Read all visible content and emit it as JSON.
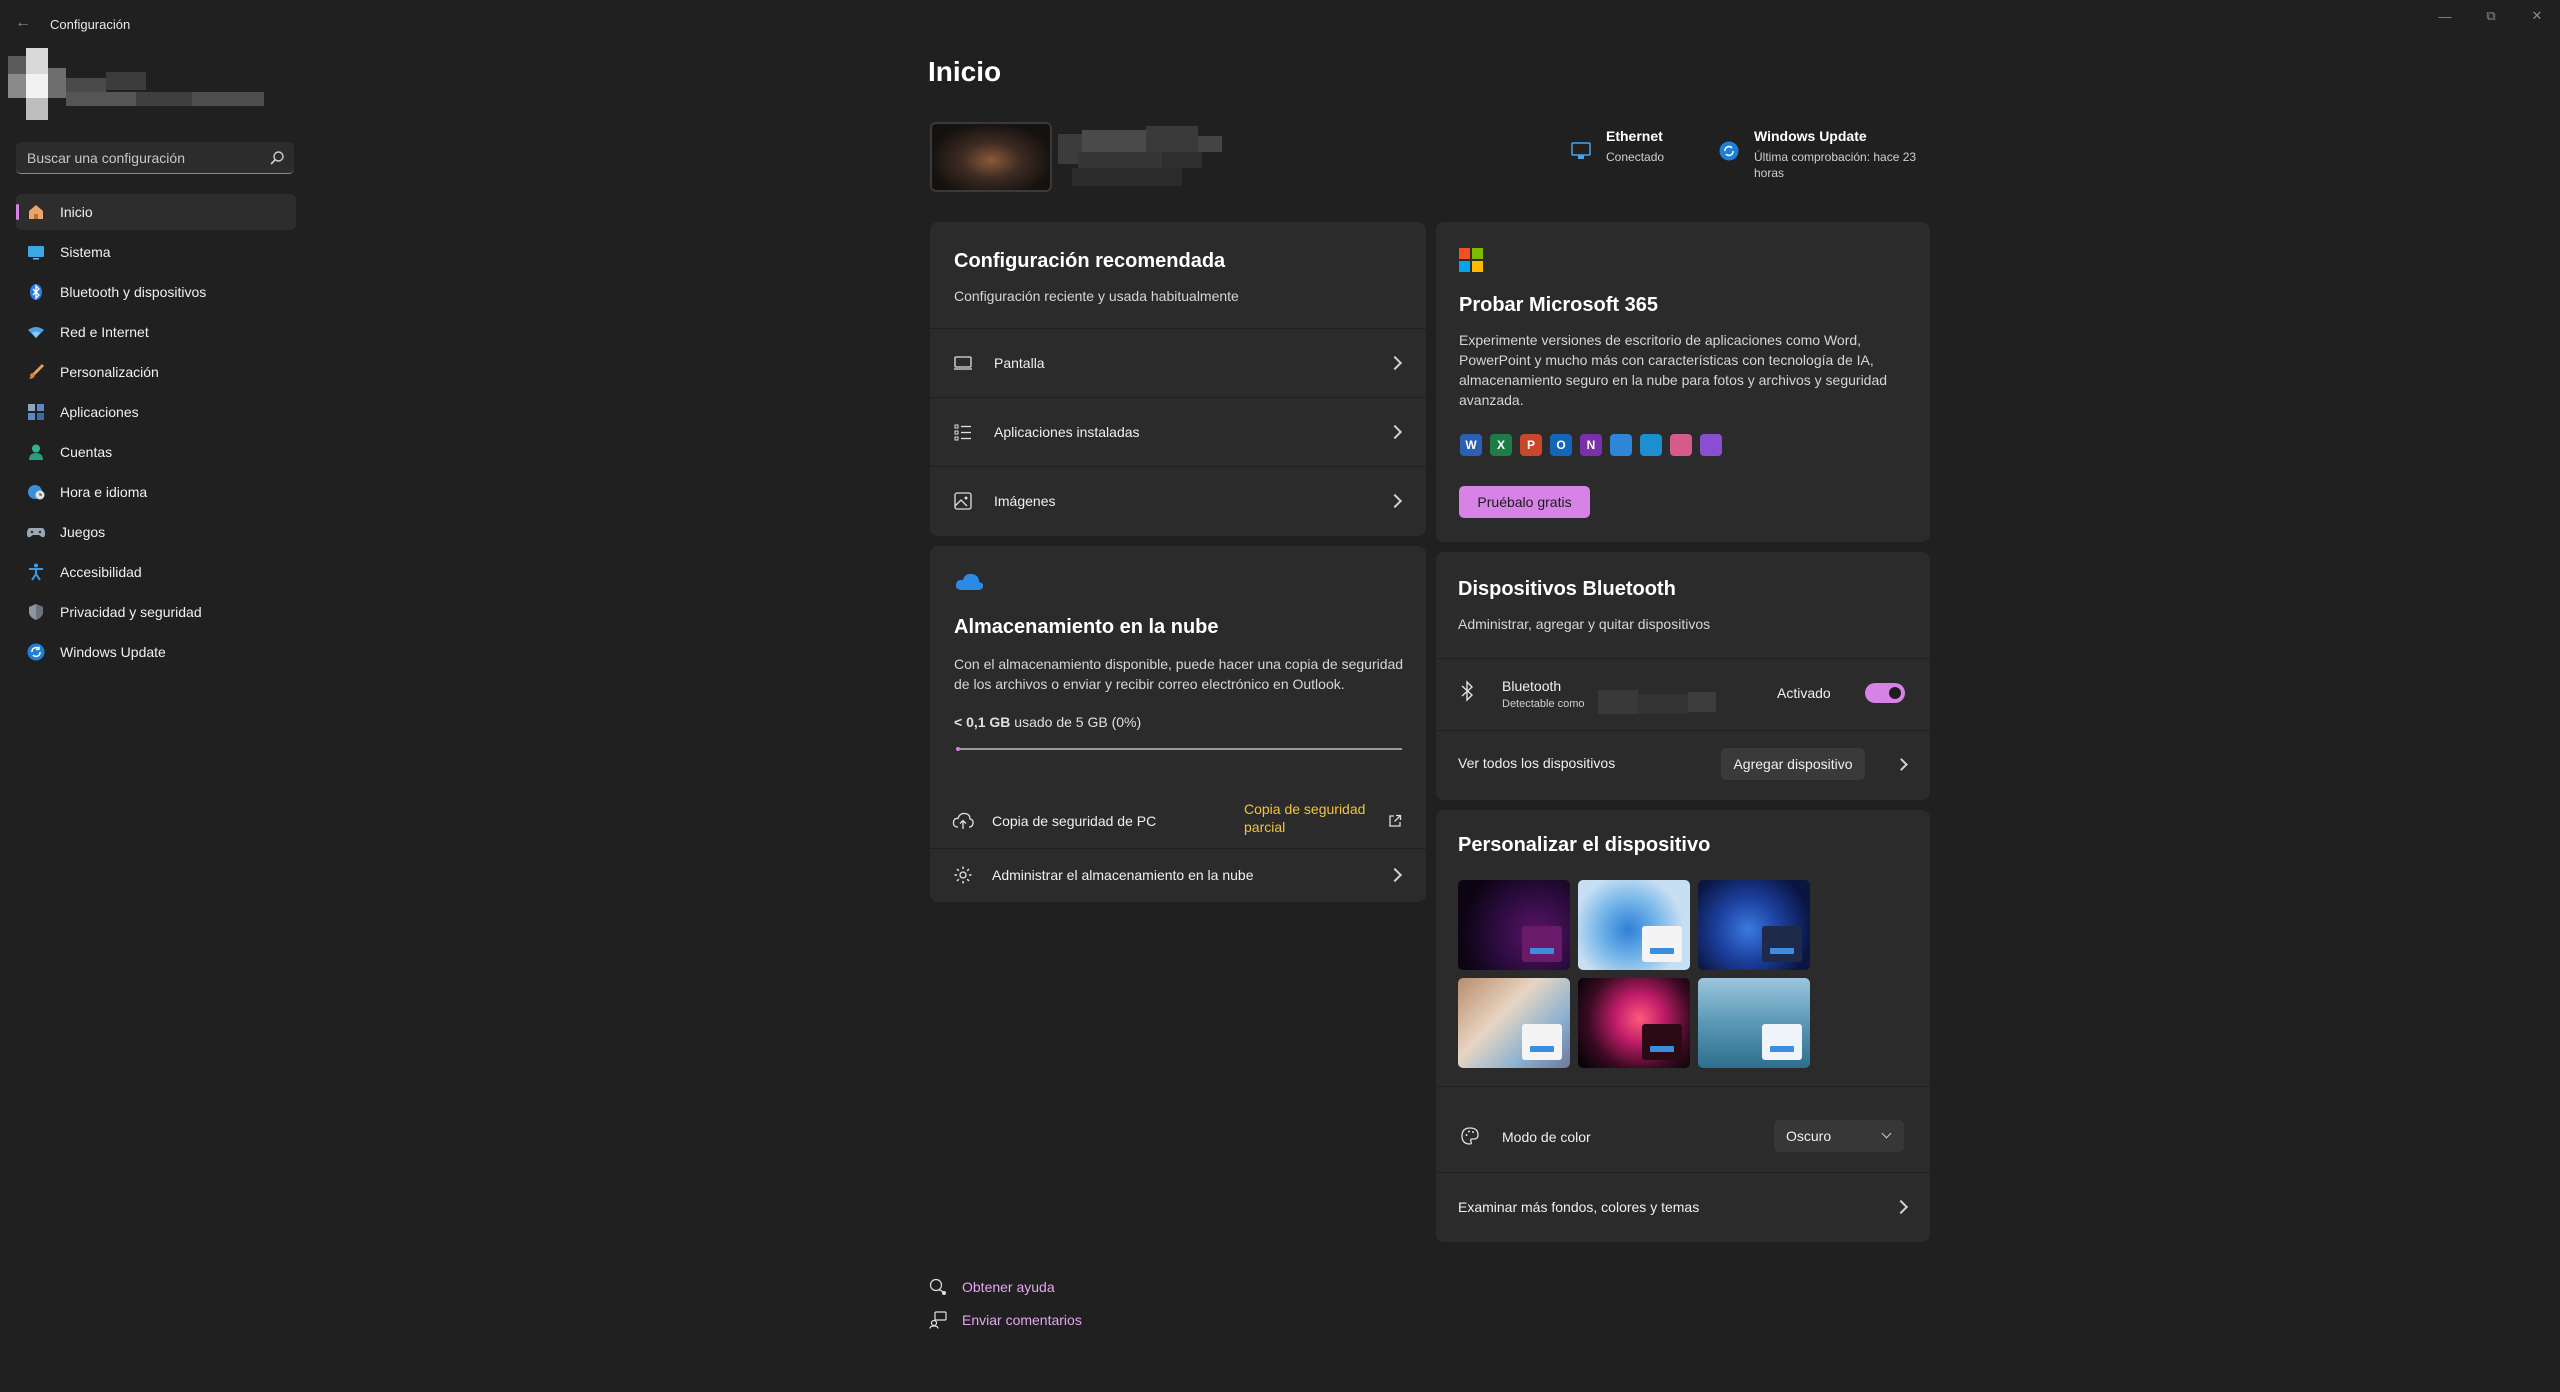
{
  "window": {
    "title": "Configuración",
    "back_icon": "back-arrow-icon",
    "controls": [
      "minimize",
      "maximize",
      "close"
    ]
  },
  "search": {
    "placeholder": "Buscar una configuración"
  },
  "sidebar": {
    "items": [
      {
        "label": "Inicio",
        "icon": "home-icon",
        "active": true
      },
      {
        "label": "Sistema",
        "icon": "system-icon"
      },
      {
        "label": "Bluetooth y dispositivos",
        "icon": "bluetooth-icon"
      },
      {
        "label": "Red e Internet",
        "icon": "wifi-icon"
      },
      {
        "label": "Personalización",
        "icon": "brush-icon"
      },
      {
        "label": "Aplicaciones",
        "icon": "apps-icon"
      },
      {
        "label": "Cuentas",
        "icon": "account-icon"
      },
      {
        "label": "Hora e idioma",
        "icon": "globe-clock-icon"
      },
      {
        "label": "Juegos",
        "icon": "gamepad-icon"
      },
      {
        "label": "Accesibilidad",
        "icon": "accessibility-icon"
      },
      {
        "label": "Privacidad y seguridad",
        "icon": "shield-icon"
      },
      {
        "label": "Windows Update",
        "icon": "update-icon"
      }
    ]
  },
  "main": {
    "title": "Inicio",
    "status": {
      "ethernet": {
        "title": "Ethernet",
        "sub": "Conectado"
      },
      "update": {
        "title": "Windows Update",
        "sub_line1": "Última comprobación: hace 23",
        "sub_line2": "horas"
      }
    },
    "recommended": {
      "title": "Configuración recomendada",
      "subtitle": "Configuración reciente y usada habitualmente",
      "items": [
        {
          "label": "Pantalla",
          "icon": "monitor-icon"
        },
        {
          "label": "Aplicaciones instaladas",
          "icon": "list-icon"
        },
        {
          "label": "Imágenes",
          "icon": "image-icon"
        }
      ]
    },
    "cloud": {
      "title": "Almacenamiento en la nube",
      "desc": "Con el almacenamiento disponible, puede hacer una copia de seguridad de los archivos o enviar y recibir correo electrónico en Outlook.",
      "usage_bold": "< 0,1 GB",
      "usage_rest": " usado de 5 GB (0%)",
      "usage_fraction": 0.01,
      "backup_label": "Copia de seguridad de PC",
      "backup_status": "Copia de seguridad parcial",
      "manage_label": "Administrar el almacenamiento en la nube",
      "colors": {
        "status": "#f2c43b"
      }
    },
    "m365": {
      "title": "Probar Microsoft 365",
      "desc": "Experimente versiones de escritorio de aplicaciones como Word, PowerPoint y mucho más con características con tecnología de IA, almacenamiento seguro en la nube para fotos y archivos y seguridad avanzada.",
      "button": "Pruébalo gratis",
      "apps": [
        {
          "letter": "W",
          "color": "#2b5fb4"
        },
        {
          "letter": "X",
          "color": "#1e7d45"
        },
        {
          "letter": "P",
          "color": "#c8472b"
        },
        {
          "letter": "O",
          "color": "#1467b8"
        },
        {
          "letter": "N",
          "color": "#7b2fa8"
        },
        {
          "letter": "",
          "color": "#2f86d6"
        },
        {
          "letter": "",
          "color": "#1d8fd0"
        },
        {
          "letter": "",
          "color": "#d65a8a"
        },
        {
          "letter": "",
          "color": "#8a4fd0"
        }
      ]
    },
    "bluetooth": {
      "title": "Dispositivos Bluetooth",
      "subtitle": "Administrar, agregar y quitar dispositivos",
      "item_title": "Bluetooth",
      "item_sub": "Detectable como",
      "state": "Activado",
      "view_all": "Ver todos los dispositivos",
      "add_button": "Agregar dispositivo"
    },
    "personalize": {
      "title": "Personalizar el dispositivo",
      "color_mode_label": "Modo de color",
      "color_mode_value": "Oscuro",
      "more_link": "Examinar más fondos, colores y temas"
    },
    "footer": {
      "help": "Obtener ayuda",
      "feedback": "Enviar comentarios"
    }
  },
  "colors": {
    "accent": "#d682e6",
    "background": "#202020",
    "card": "#2b2b2b"
  }
}
